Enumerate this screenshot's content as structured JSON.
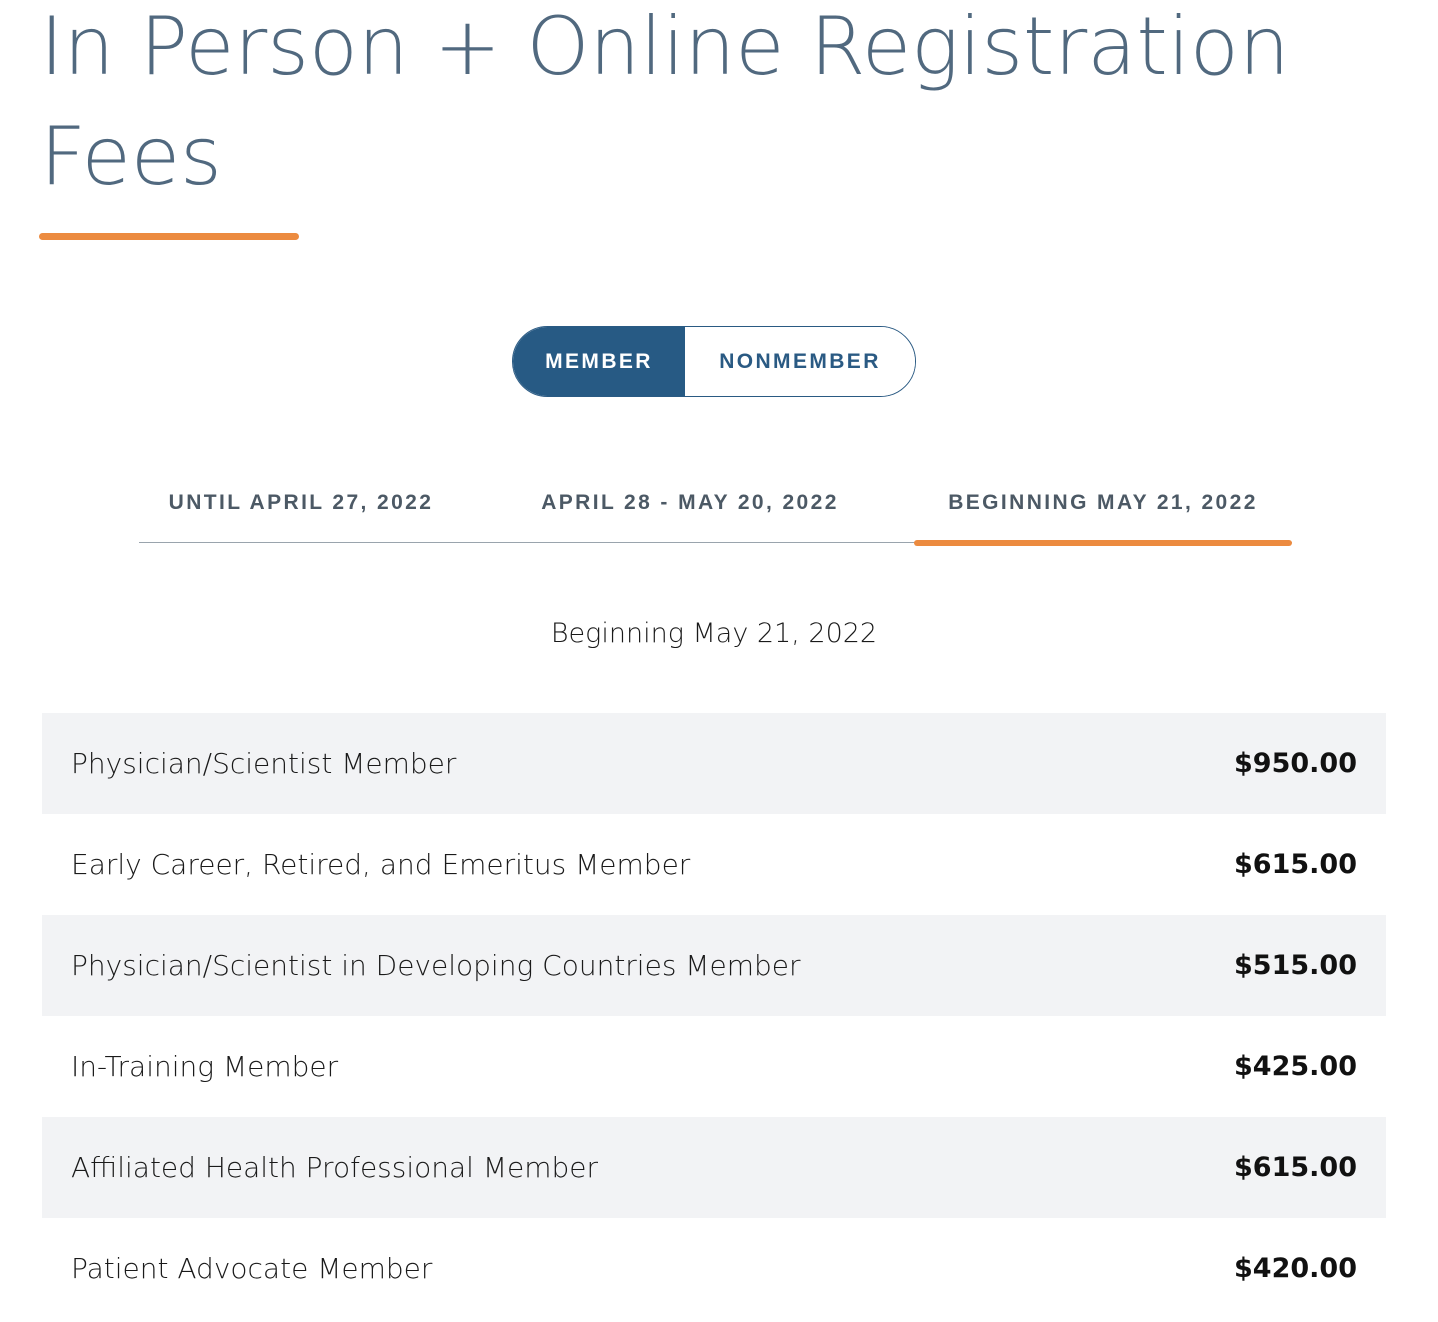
{
  "page": {
    "title": "In Person + Online Registration Fees"
  },
  "membership_toggle": {
    "member_label": "MEMBER",
    "nonmember_label": "NONMEMBER",
    "selected": "MEMBER"
  },
  "date_tabs": {
    "tab1": "UNTIL APRIL 27, 2022",
    "tab2": "APRIL 28 - MAY 20, 2022",
    "tab3": "BEGINNING MAY 21, 2022",
    "selected": "BEGINNING MAY 21, 2022"
  },
  "section": {
    "heading": "Beginning May 21, 2022"
  },
  "fees": [
    {
      "label": "Physician/Scientist Member",
      "price": "$950.00"
    },
    {
      "label": "Early Career, Retired, and Emeritus Member",
      "price": "$615.00"
    },
    {
      "label": "Physician/Scientist in Developing Countries Member",
      "price": "$515.00"
    },
    {
      "label": "In-Training Member",
      "price": "$425.00"
    },
    {
      "label": "Affiliated Health Professional Member",
      "price": "$615.00"
    },
    {
      "label": "Patient Advocate Member",
      "price": "$420.00"
    }
  ],
  "colors": {
    "title": "#51697f",
    "accent": "#ec8b40",
    "toggle_active": "#275a84",
    "row_shade": "#f2f3f5"
  }
}
